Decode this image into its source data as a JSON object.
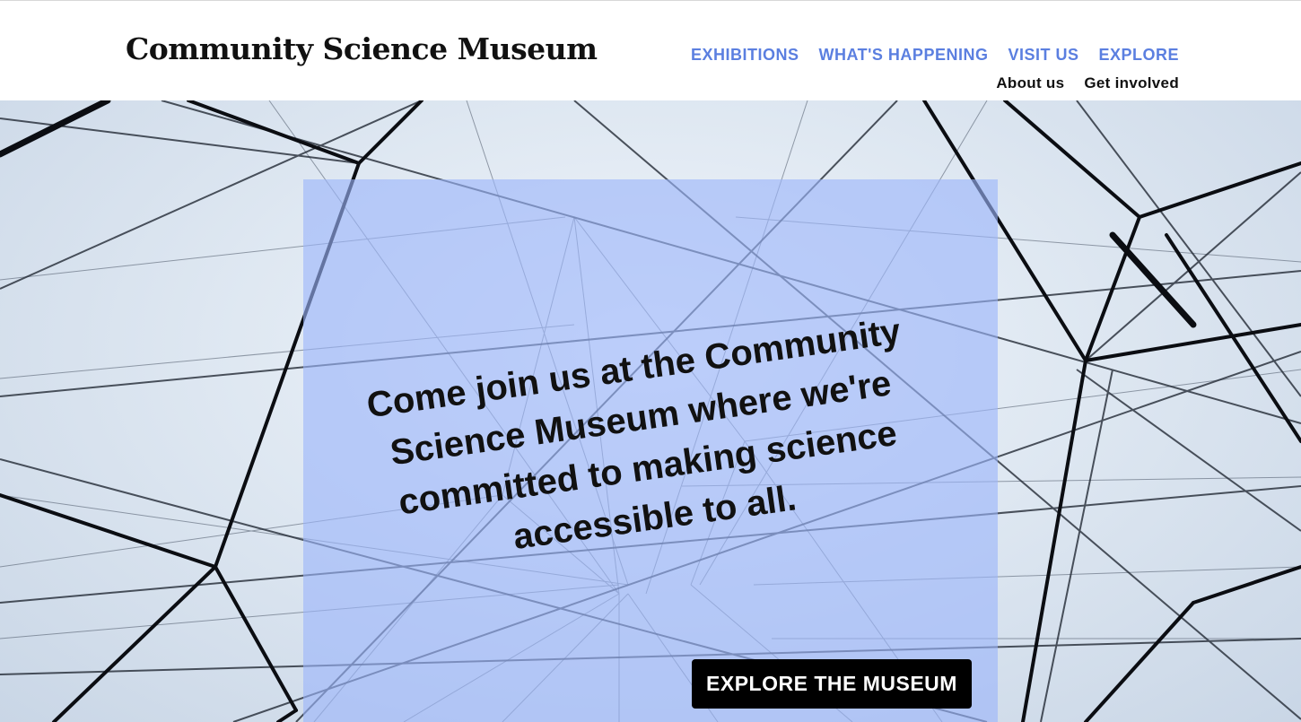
{
  "header": {
    "site_title": "Community Science Museum",
    "primary_nav": [
      {
        "label": "EXHIBITIONS"
      },
      {
        "label": "WHAT'S HAPPENING"
      },
      {
        "label": "VISIT US"
      },
      {
        "label": "EXPLORE"
      }
    ],
    "secondary_nav": [
      {
        "label": "About us"
      },
      {
        "label": "Get involved"
      }
    ]
  },
  "hero": {
    "background_image": "network-of-cables-photo",
    "tagline": "Come join us at the Community Science Museum where we're committed to making science accessible to all.",
    "cta_label": "EXPLORE THE MUSEUM"
  },
  "colors": {
    "nav_accent": "#5b7fe0",
    "panel_overlay": "#9bb4fa",
    "cta_background": "#000000",
    "cta_text": "#ffffff"
  }
}
